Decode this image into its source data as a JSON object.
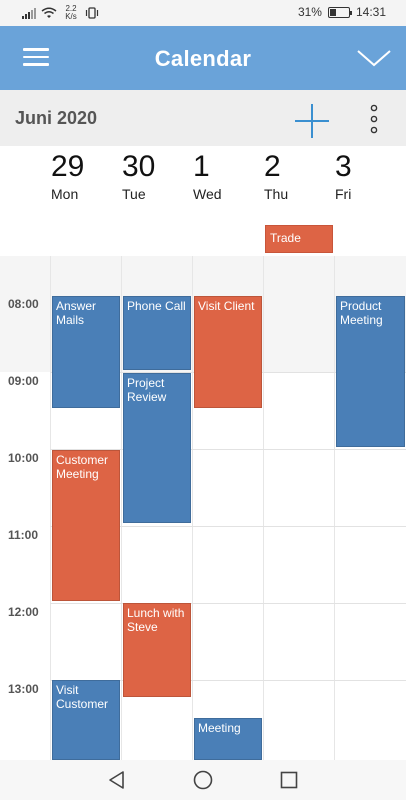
{
  "status_bar": {
    "net_speed_value": "2.2",
    "net_speed_unit": "K/s",
    "battery_percent": "31%",
    "battery_level": 0.31,
    "time": "14:31"
  },
  "app_bar": {
    "title": "Calendar"
  },
  "month_bar": {
    "month_label": "Juni 2020"
  },
  "days": [
    {
      "num": "29",
      "name": "Mon"
    },
    {
      "num": "30",
      "name": "Tue"
    },
    {
      "num": "1",
      "name": "Wed"
    },
    {
      "num": "2",
      "name": "Thu"
    },
    {
      "num": "3",
      "name": "Fri"
    }
  ],
  "all_day_events": [
    {
      "title": "Trade",
      "day": "Thu",
      "color": "#dd6445"
    }
  ],
  "time_labels": [
    "08:00",
    "09:00",
    "10:00",
    "11:00",
    "12:00",
    "13:00"
  ],
  "events": [
    {
      "title": "Answer Mails",
      "day": "Mon",
      "start": "08:00",
      "end": "09:30",
      "color": "#4a7fb7"
    },
    {
      "title": "Phone Call",
      "day": "Tue",
      "start": "08:00",
      "end": "09:00",
      "color": "#4a7fb7"
    },
    {
      "title": "Visit Client",
      "day": "Wed",
      "start": "08:00",
      "end": "09:30",
      "color": "#dd6445"
    },
    {
      "title": "Product Meeting",
      "day": "Fri",
      "start": "08:00",
      "end": "10:00",
      "color": "#4a7fb7"
    },
    {
      "title": "Project Review",
      "day": "Tue",
      "start": "09:00",
      "end": "11:00",
      "color": "#4a7fb7"
    },
    {
      "title": "Customer Meeting",
      "day": "Mon",
      "start": "10:00",
      "end": "12:00",
      "color": "#dd6445"
    },
    {
      "title": "Lunch with Steve",
      "day": "Tue",
      "start": "12:00",
      "end": "13:15",
      "color": "#dd6445"
    },
    {
      "title": "Visit Customer",
      "day": "Mon",
      "start": "13:00",
      "end": "14:00",
      "color": "#4a7fb7"
    },
    {
      "title": "Meeting",
      "day": "Wed",
      "start": "13:30",
      "end": "14:00",
      "color": "#4a7fb7"
    }
  ],
  "icons": {
    "menu": "hamburger-icon",
    "collapse": "chevron-down-icon",
    "add": "plus-icon",
    "more": "more-vertical-icon",
    "nav_back": "triangle-back-icon",
    "nav_home": "circle-home-icon",
    "nav_recents": "square-recents-icon"
  },
  "colors": {
    "app_bar": "#6aa3d9",
    "event_blue": "#4a7fb7",
    "event_orange": "#dd6445",
    "accent_plus": "#3a8fd0"
  }
}
